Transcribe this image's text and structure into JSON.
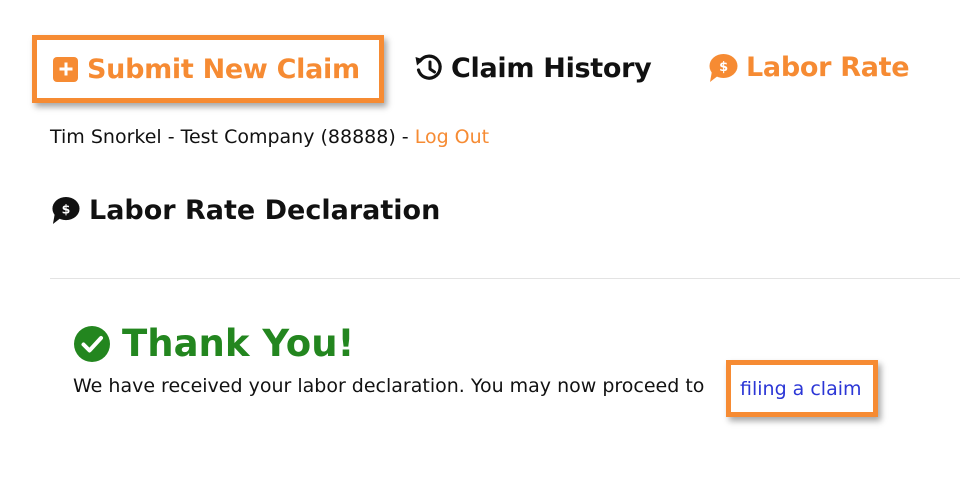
{
  "nav": {
    "submit_label": "Submit New Claim",
    "history_label": "Claim History",
    "labor_label": "Labor Rate"
  },
  "user": {
    "info": "Tim Snorkel - Test Company (88888) - ",
    "logout_label": "Log Out"
  },
  "page": {
    "heading": "Labor Rate Declaration"
  },
  "confirmation": {
    "title": "Thank You!",
    "message": "We have received your labor declaration. You may now proceed to",
    "link_label": "filing a claim"
  },
  "colors": {
    "accent": "#f68b33",
    "success": "#23861f",
    "link": "#2b36d6",
    "text": "#111111"
  },
  "icons": {
    "submit": "plus-square-icon",
    "history": "history-icon",
    "labor": "dollar-speech-bubble-icon",
    "success": "check-circle-icon"
  }
}
